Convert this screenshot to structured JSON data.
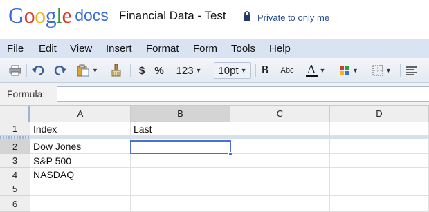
{
  "header": {
    "logo_text": "Google",
    "product": "docs",
    "doc_title": "Financial Data - Test",
    "privacy": "Private to only me",
    "logo_colors": [
      "#3a6bd6",
      "#d8382b",
      "#f1b51c",
      "#3a6bd6",
      "#2c9a3e",
      "#d8382b"
    ]
  },
  "menu": {
    "items": [
      "File",
      "Edit",
      "View",
      "Insert",
      "Format",
      "Form",
      "Tools",
      "Help"
    ]
  },
  "toolbar": {
    "icons": [
      "print-icon",
      "undo-icon",
      "redo-icon",
      "paste-icon",
      "paint-format-icon",
      "currency-icon",
      "percent-icon",
      "number-format-icon",
      "font-size-select",
      "bold-icon",
      "strikethrough-icon",
      "text-color-icon",
      "fill-color-icon",
      "borders-icon",
      "align-icon"
    ],
    "currency": "$",
    "percent": "%",
    "number_format": "123",
    "font_size": "10pt",
    "bold": "B",
    "strikethrough": "Abc",
    "text_color": "A"
  },
  "formula": {
    "label": "Formula:",
    "value": ""
  },
  "sheet": {
    "columns": [
      "A",
      "B",
      "C",
      "D"
    ],
    "selected_column": "B",
    "selected_row": "2",
    "rows": [
      {
        "num": "1",
        "cells": [
          "Index",
          "Last",
          "",
          ""
        ]
      },
      {
        "num": "2",
        "cells": [
          "Dow Jones",
          "",
          "",
          ""
        ]
      },
      {
        "num": "3",
        "cells": [
          "S&P 500",
          "",
          "",
          ""
        ]
      },
      {
        "num": "4",
        "cells": [
          "NASDAQ",
          "",
          "",
          ""
        ]
      },
      {
        "num": "5",
        "cells": [
          "",
          "",
          "",
          ""
        ]
      },
      {
        "num": "6",
        "cells": [
          "",
          "",
          "",
          ""
        ]
      }
    ]
  }
}
